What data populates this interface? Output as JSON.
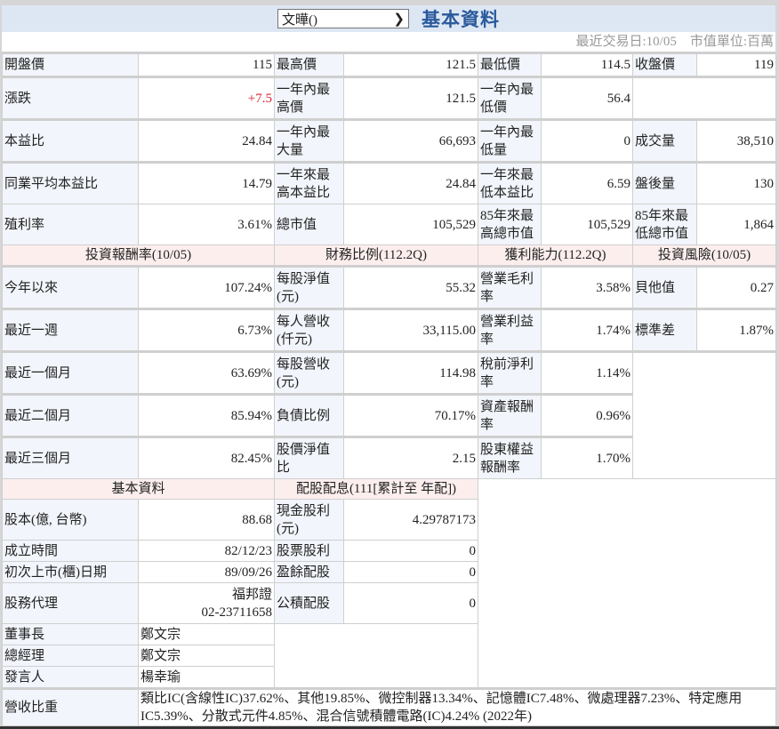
{
  "header": {
    "stock_select": "文曄()",
    "title": "基本資料",
    "info": "最近交易日:10/05　市值單位:百萬"
  },
  "quote": {
    "open_l": "開盤價",
    "open": "115",
    "high_l": "最高價",
    "high": "121.5",
    "low_l": "最低價",
    "low": "114.5",
    "close_l": "收盤價",
    "close": "119",
    "chg_l": "漲跌",
    "chg": "+7.5",
    "yhigh_l": "一年內最高價",
    "yhigh": "121.5",
    "ylow_l": "一年內最低價",
    "ylow": "56.4",
    "pe_l": "本益比",
    "pe": "24.84",
    "yvolmax_l": "一年內最大量",
    "yvolmax": "66,693",
    "yvolmin_l": "一年內最低量",
    "yvolmin": "0",
    "vol_l": "成交量",
    "vol": "38,510",
    "indpe_l": "同業平均本益比",
    "indpe": "14.79",
    "ypehigh_l": "一年來最高本益比",
    "ypehigh": "24.84",
    "ypelow_l": "一年來最低本益比",
    "ypelow": "6.59",
    "after_l": "盤後量",
    "after": "130",
    "yield_l": "殖利率",
    "yield": "3.61%",
    "mcap_l": "總市值",
    "mcap": "105,529",
    "mcaphigh_l": "85年來最高總市值",
    "mcaphigh": "105,529",
    "mcaplow_l": "85年來最低總市值",
    "mcaplow": "1,864"
  },
  "sections": {
    "ret": "投資報酬率(10/05)",
    "fin": "財務比例(112.2Q)",
    "prof": "獲利能力(112.2Q)",
    "risk": "投資風險(10/05)",
    "basic": "基本資料",
    "div": "配股配息(111[累計至 年配])"
  },
  "rows": [
    {
      "a": "今年以來",
      "av": "107.24%",
      "b": "每股淨值(元)",
      "bv": "55.32",
      "c": "營業毛利率",
      "cv": "3.58%",
      "d": "貝他值",
      "dv": "0.27"
    },
    {
      "a": "最近一週",
      "av": "6.73%",
      "b": "每人營收(仟元)",
      "bv": "33,115.00",
      "c": "營業利益率",
      "cv": "1.74%",
      "d": "標準差",
      "dv": "1.87%"
    },
    {
      "a": "最近一個月",
      "av": "63.69%",
      "b": "每股營收(元)",
      "bv": "114.98",
      "c": "稅前淨利率",
      "cv": "1.14%"
    },
    {
      "a": "最近二個月",
      "av": "85.94%",
      "b": "負債比例",
      "bv": "70.17%",
      "c": "資產報酬率",
      "cv": "0.96%"
    },
    {
      "a": "最近三個月",
      "av": "82.45%",
      "b": "股價淨值比",
      "bv": "2.15",
      "c": "股東權益報酬率",
      "cv": "1.70%"
    }
  ],
  "basic": {
    "cap_l": "股本(億, 台幣)",
    "cap": "88.68",
    "cash_l": "現金股利(元)",
    "cash": "4.29787173",
    "est_l": "成立時間",
    "est": "82/12/23",
    "stock_l": "股票股利",
    "stock": "0",
    "ipo_l": "初次上市(櫃)日期",
    "ipo": "89/09/26",
    "surplus_l": "盈餘配股",
    "surplus": "0",
    "agent_l": "股務代理",
    "agent1": "福邦證",
    "agent2": "02-23711658",
    "reserve_l": "公積配股",
    "reserve": "0",
    "chair_l": "董事長",
    "chair": "鄭文宗",
    "gm_l": "總經理",
    "gm": "鄭文宗",
    "spk_l": "發言人",
    "spk": "楊幸瑜",
    "rev_l": "營收比重",
    "rev": "類比IC(含線性IC)37.62%、其他19.85%、微控制器13.34%、記憶體IC7.48%、微處理器7.23%、特定應用IC5.39%、分散式元件4.85%、混合信號積體電路(IC)4.24% (2022年)"
  }
}
